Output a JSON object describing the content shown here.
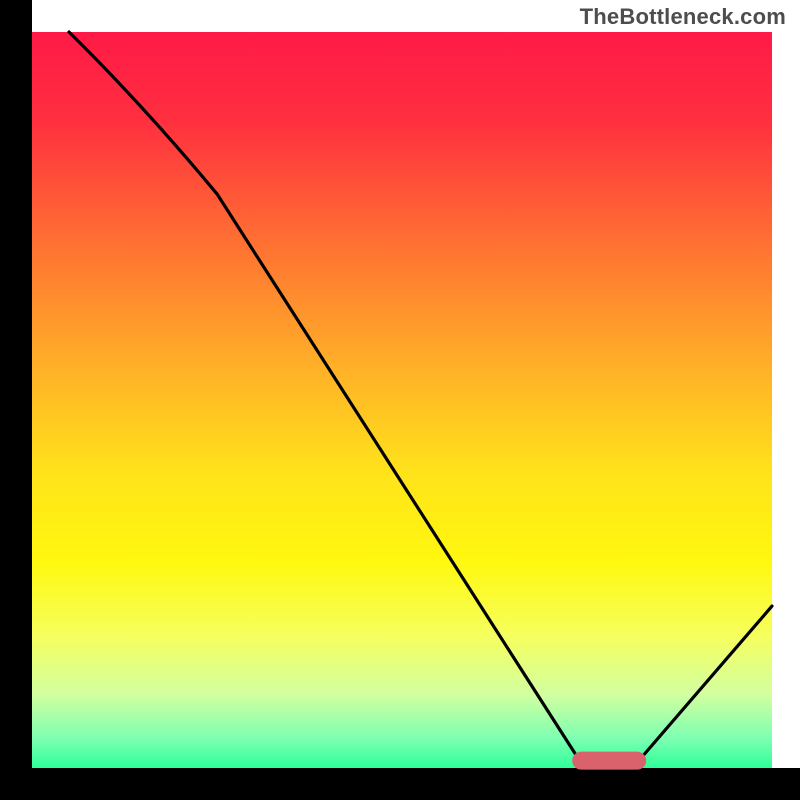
{
  "watermark": "TheBottleneck.com",
  "colors": {
    "stroke": "#000000",
    "marker": "#d9626d",
    "gradient_stops": [
      {
        "offset": 0.0,
        "color": "#ff1a47"
      },
      {
        "offset": 0.12,
        "color": "#ff2f3f"
      },
      {
        "offset": 0.28,
        "color": "#ff6e33"
      },
      {
        "offset": 0.45,
        "color": "#ffae28"
      },
      {
        "offset": 0.6,
        "color": "#ffe31a"
      },
      {
        "offset": 0.72,
        "color": "#fff80f"
      },
      {
        "offset": 0.82,
        "color": "#f6ff5e"
      },
      {
        "offset": 0.9,
        "color": "#d2ffa0"
      },
      {
        "offset": 0.96,
        "color": "#7dffb1"
      },
      {
        "offset": 1.0,
        "color": "#2dff9a"
      }
    ]
  },
  "chart_data": {
    "type": "line",
    "title": "",
    "xlabel": "",
    "ylabel": "",
    "xlim": [
      0,
      100
    ],
    "ylim": [
      0,
      100
    ],
    "x": [
      5,
      25,
      74,
      82,
      100
    ],
    "values": [
      100,
      78,
      1,
      1,
      22
    ],
    "marker_segment": {
      "x_start": 73,
      "x_end": 83,
      "y": 1
    },
    "notes": "Single black curve on a red-to-green vertical gradient. Values are bottleneck-percentage-like readings estimated from the plot: the curve starts near the top-left, kinks around x≈25, descends roughly linearly to a flat minimum near x≈74–82 (highlighted by a short rounded red bar at the bottom), then rises toward the right edge. No axis ticks or labels are shown."
  }
}
